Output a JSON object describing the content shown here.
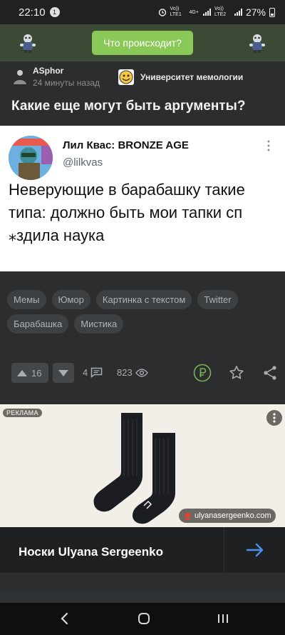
{
  "status": {
    "time": "22:10",
    "notif_count": "1",
    "battery": "27%",
    "net1": "Vo)) LTE1",
    "net2": "Vo)) LTE2",
    "net_type": "4G+"
  },
  "header": {
    "button_label": "Что происходит?"
  },
  "post": {
    "author": "ASphor",
    "time": "24 минуты назад",
    "community": "Университет мемологии",
    "title": "Какие еще могут быть аргументы?"
  },
  "tweet": {
    "name": "Лил Квас: BRONZE AGE",
    "handle": "@lilkvas",
    "text": "Неверующие в барабашку такие типа: должно быть мои тапки сп ⁎здила наука"
  },
  "tags": [
    "Мемы",
    "Юмор",
    "Картинка с текстом",
    "Twitter",
    "Барабашка",
    "Мистика"
  ],
  "actions": {
    "rating": "16",
    "comments": "4",
    "views": "823"
  },
  "ad": {
    "badge": "РЕКЛАМА",
    "url": "ulyanasergeenko.com",
    "title": "Носки Ulyana Sergeenko"
  },
  "colors": {
    "accent": "#8ac858",
    "header_bg": "#3c4a35",
    "page_bg": "#2b2d2f",
    "link_arrow": "#4a8ff0"
  }
}
